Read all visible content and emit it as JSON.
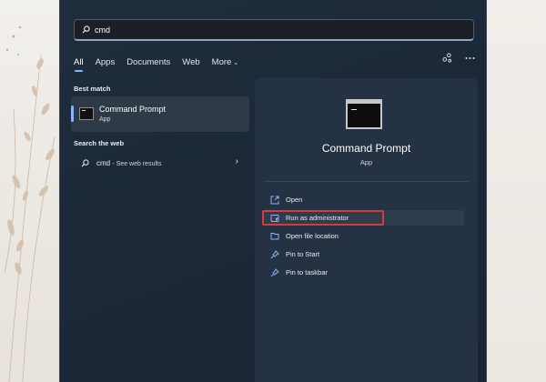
{
  "search": {
    "value": "cmd",
    "icon": "search-icon"
  },
  "tabs": [
    {
      "label": "All",
      "active": true
    },
    {
      "label": "Apps",
      "active": false
    },
    {
      "label": "Documents",
      "active": false
    },
    {
      "label": "Web",
      "active": false
    },
    {
      "label": "More",
      "active": false
    }
  ],
  "top_icons": [
    "share-network-icon",
    "more-options-icon"
  ],
  "best_match": {
    "section_label": "Best match",
    "title": "Command Prompt",
    "subtitle": "App"
  },
  "web": {
    "section_label": "Search the web",
    "result_query": "cmd",
    "result_suffix": "- See web results"
  },
  "detail": {
    "title": "Command Prompt",
    "subtitle": "App",
    "actions": [
      {
        "label": "Open",
        "icon": "open-icon"
      },
      {
        "label": "Run as administrator",
        "icon": "shield-icon",
        "highlighted": true
      },
      {
        "label": "Open file location",
        "icon": "folder-icon"
      },
      {
        "label": "Pin to Start",
        "icon": "pin-icon"
      },
      {
        "label": "Pin to taskbar",
        "icon": "pin-icon"
      }
    ]
  },
  "colors": {
    "accent": "#8ab4f8",
    "highlight_border": "#d83a3a",
    "window_bg": "#1f2d3d",
    "pane_bg": "#253243"
  }
}
